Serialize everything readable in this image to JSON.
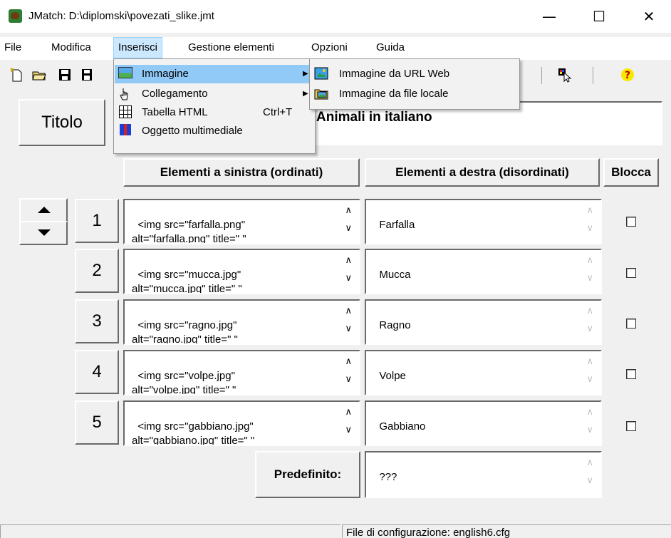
{
  "window": {
    "title": "JMatch: D:\\diplomski\\povezati_slike.jmt",
    "minimize": "—",
    "maximize": "☐",
    "close": "✕"
  },
  "menubar": [
    "File",
    "Modifica",
    "Inserisci",
    "Gestione elementi",
    "Opzioni",
    "Guida"
  ],
  "toolbar": {
    "icons": [
      "new-file-icon",
      "open-folder-icon",
      "save-icon",
      "save-as-icon",
      "cut-icon",
      "help-cursor-icon",
      "help-icon"
    ]
  },
  "dropdown": {
    "items": [
      {
        "label": "Immagine",
        "has_submenu": true,
        "icon": "image-icon"
      },
      {
        "label": "Collegamento",
        "has_submenu": true,
        "icon": "link-hand-icon"
      },
      {
        "label": "Tabella HTML",
        "shortcut": "Ctrl+T",
        "icon": "table-icon"
      },
      {
        "label": "Oggetto multimediale",
        "icon": "gift-icon"
      }
    ],
    "submenu": [
      {
        "label": "Immagine da URL Web",
        "icon": "web-image-icon"
      },
      {
        "label": "Immagine da file locale",
        "icon": "local-image-icon"
      }
    ]
  },
  "title_button": "Titolo",
  "title_value": "Animali in italiano",
  "headers": {
    "left": "Elementi a sinistra (ordinati)",
    "right": "Elementi a destra (disordinati)",
    "lock": "Blocca"
  },
  "rows": [
    {
      "num": "1",
      "left": "<img src=\"farfalla.png\"\nalt=\"farfalla.png\" title=\" \"",
      "right": "Farfalla"
    },
    {
      "num": "2",
      "left": "<img src=\"mucca.jpg\"\nalt=\"mucca.jpg\" title=\" \"",
      "right": "Mucca"
    },
    {
      "num": "3",
      "left": "<img src=\"ragno.jpg\"\nalt=\"ragno.jpg\" title=\" \"",
      "right": "Ragno"
    },
    {
      "num": "4",
      "left": "<img src=\"volpe.jpg\"\nalt=\"volpe.jpg\" title=\" \"",
      "right": "Volpe"
    },
    {
      "num": "5",
      "left": "<img src=\"gabbiano.jpg\"\nalt=\"gabbiano.jpg\" title=\" \"",
      "right": "Gabbiano"
    }
  ],
  "default_button": "Predefinito:",
  "default_value": "???",
  "status": "File di configurazione: english6.cfg",
  "colors": {
    "menu_highlight": "#91c9f7",
    "menu_open": "#cce8ff"
  }
}
